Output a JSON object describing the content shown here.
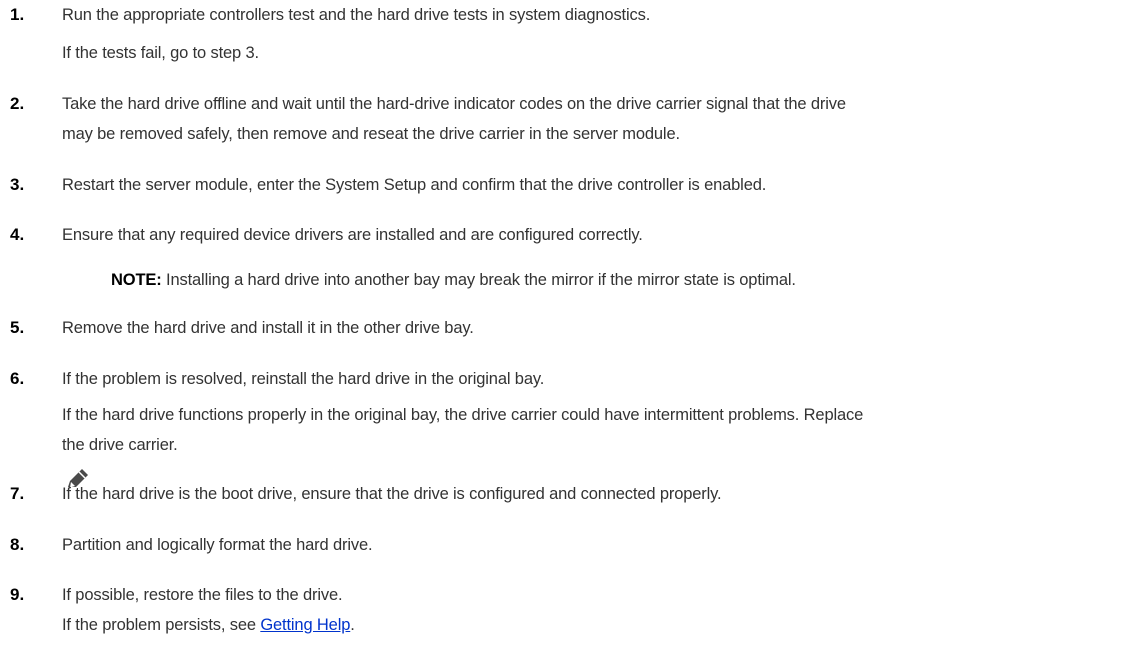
{
  "steps": [
    {
      "number": "1.",
      "lines": [
        "Run the appropriate controllers test and the hard drive tests in system diagnostics.",
        "If the tests fail, go to step 3."
      ]
    },
    {
      "number": "2.",
      "lines": [
        "Take the hard drive offline and wait until the hard-drive indicator codes on the drive carrier signal that the drive",
        "may be removed safely, then remove and reseat the drive carrier in the server module."
      ]
    },
    {
      "number": "3.",
      "lines": [
        "Restart the server module, enter the System Setup and confirm that the drive controller is enabled."
      ]
    },
    {
      "number": "4.",
      "lines": [
        "Ensure that any required device drivers are installed and are configured correctly."
      ]
    },
    {
      "number": "5.",
      "lines": [
        "Remove the hard drive and install it in the other drive bay."
      ]
    },
    {
      "number": "6.",
      "lines": [
        "If the problem is resolved, reinstall the hard drive in the original bay.",
        "If the hard drive functions properly in the original bay, the drive carrier could have intermittent problems. Replace",
        "the drive carrier."
      ]
    },
    {
      "number": "7.",
      "lines": [
        "If the hard drive is the boot drive, ensure that the drive is configured and connected properly."
      ]
    },
    {
      "number": "8.",
      "lines": [
        "Partition and logically format the hard drive."
      ]
    },
    {
      "number": "9.",
      "lines": [
        "If possible, restore the files to the drive."
      ]
    }
  ],
  "note": {
    "label": "NOTE:",
    "text": " Installing a hard drive into another bay may break the mirror if the mirror state is optimal.",
    "icon": "note-pencil-icon"
  },
  "final_line": {
    "prefix": "If the problem persists, see ",
    "link_text": "Getting Help",
    "suffix": "."
  },
  "colors": {
    "text": "#333333",
    "numbers": "#000000",
    "link": "#0033cc"
  }
}
